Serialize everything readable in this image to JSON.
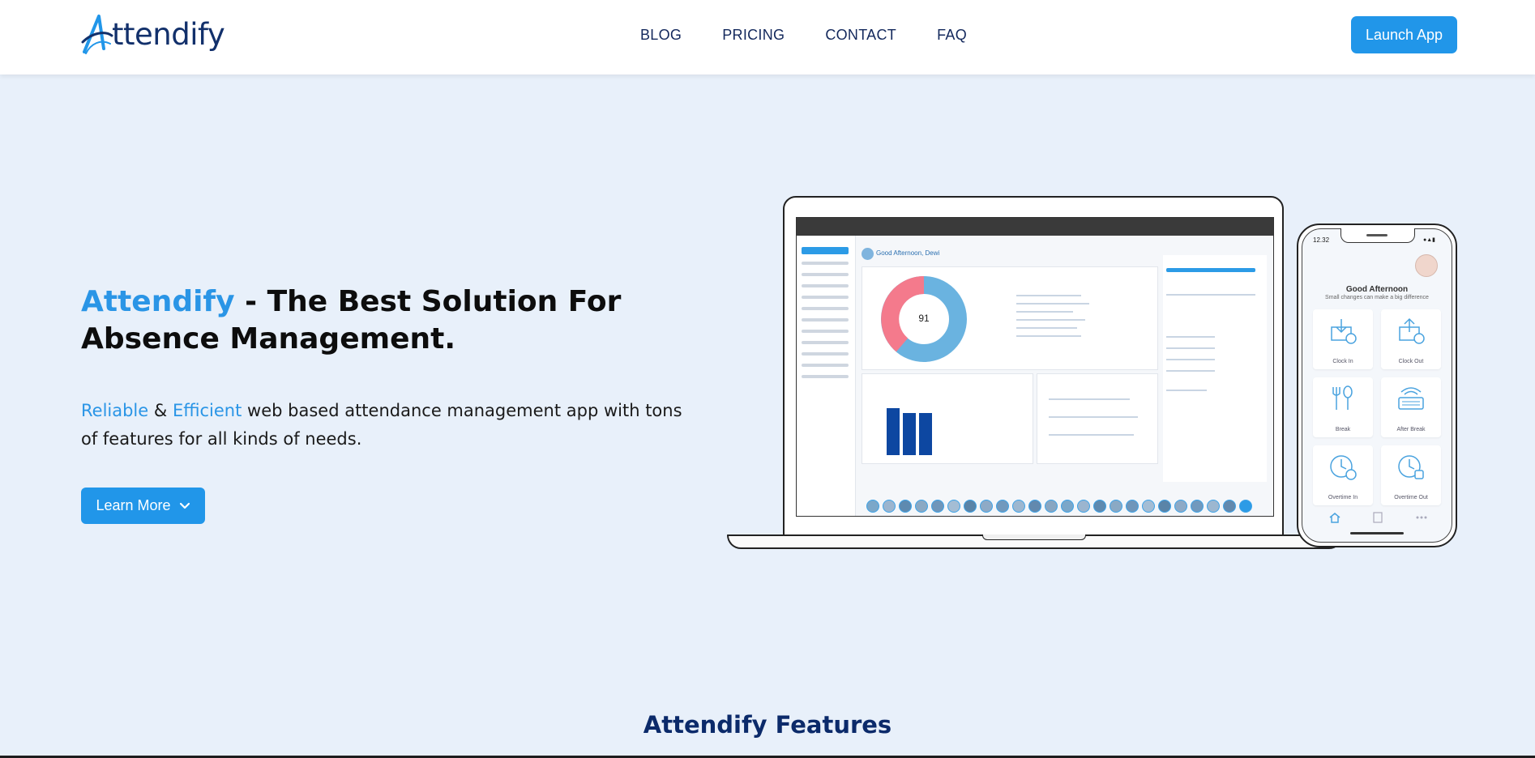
{
  "header": {
    "logo_text": "ttendify",
    "logo_letter": "A",
    "nav": [
      "BLOG",
      "PRICING",
      "CONTACT",
      "FAQ"
    ],
    "launch_label": "Launch App"
  },
  "hero": {
    "title_brand": "Attendify",
    "title_rest": " - The Best Solution For Absence Management.",
    "sub_reliable": "Reliable",
    "sub_and": " & ",
    "sub_efficient": "Efficient",
    "sub_rest": " web based attendance management app with tons of features for all kinds of needs.",
    "learn_more_label": "Learn More"
  },
  "mockup": {
    "desktop_greeting": "Good Afternoon, Dewi",
    "donut_value": "91",
    "phone_time": "12.32",
    "phone_greeting": "Good Afternoon",
    "phone_greeting_sub": "Small changes can make a big difference",
    "tiles": [
      "Clock In",
      "Clock Out",
      "Break",
      "After Break",
      "Overtime In",
      "Overtime Out"
    ]
  },
  "features": {
    "title": "Attendify Features"
  },
  "colors": {
    "accent": "#2196e9",
    "navy": "#12306b",
    "background": "#e8f0fa",
    "donut_pink": "#f47a8c",
    "donut_blue": "#6ab3e0",
    "bar_blue": "#0d47a1"
  }
}
